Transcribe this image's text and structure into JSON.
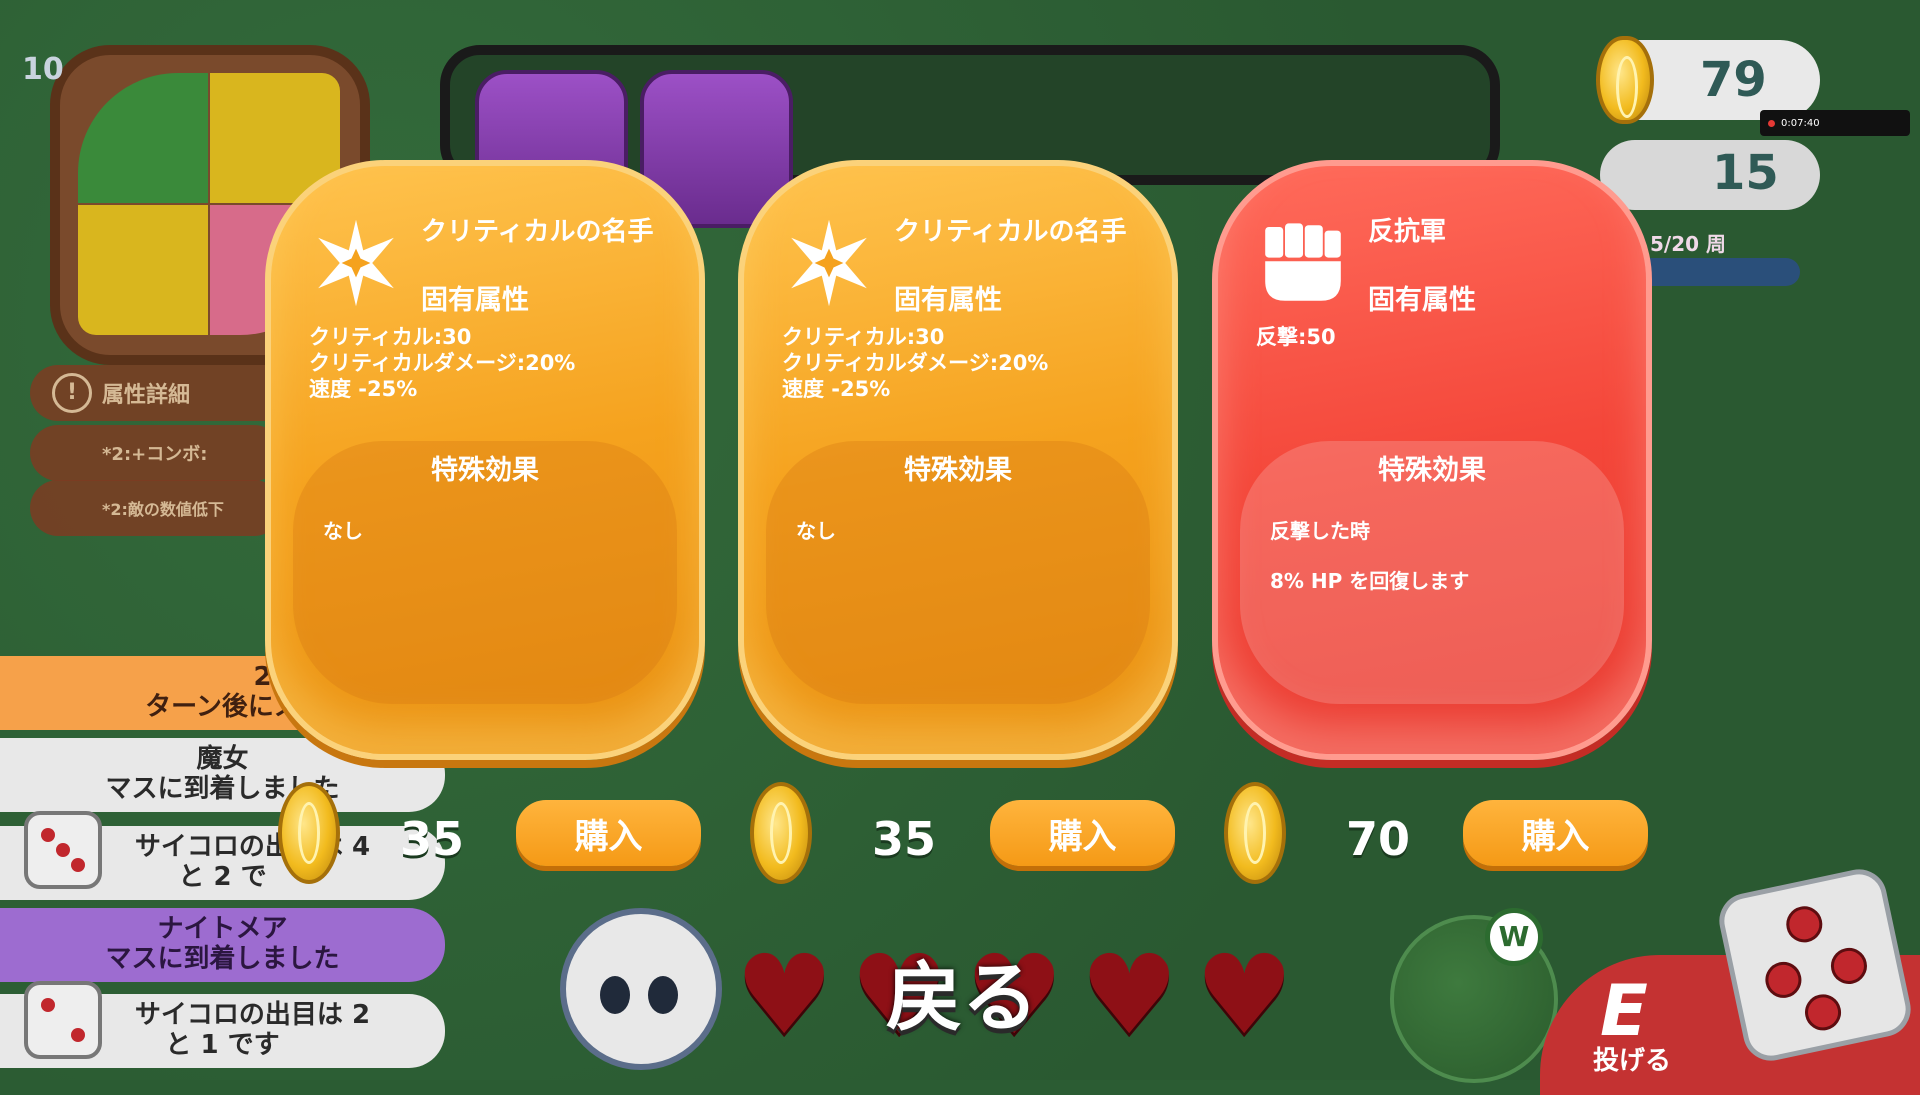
{
  "hud": {
    "level": "10",
    "coins": "79",
    "round": "15",
    "laps": "5/20 周",
    "recording_time": "0:07:40"
  },
  "sidebar": {
    "attribute_detail": "属性詳細",
    "combo_note": "*2:+コンボ:",
    "enemy_note": "*2:敵の数値低下"
  },
  "event_log": [
    {
      "line1": "2",
      "line2": "ターン後にス"
    },
    {
      "line1": "魔女",
      "line2": "マスに到着しました"
    },
    {
      "line1": "サイコロの出目は 4",
      "line2": "と 2 で"
    },
    {
      "line1": "ナイトメア",
      "line2": "マスに到着しました"
    },
    {
      "line1": "サイコロの出目は 2",
      "line2": "と 1 です"
    }
  ],
  "shop": {
    "cards": [
      {
        "icon": "star-burst-icon",
        "title": "クリティカルの名手",
        "subtitle": "固有属性",
        "stats": [
          "クリティカル:30",
          "クリティカルダメージ:20%",
          "速度 -25%"
        ],
        "effect_title": "特殊効果",
        "effect_lines": [
          "なし"
        ],
        "price": "35",
        "buy_label": "購入",
        "color": "#f5a21e"
      },
      {
        "icon": "star-burst-icon",
        "title": "クリティカルの名手",
        "subtitle": "固有属性",
        "stats": [
          "クリティカル:30",
          "クリティカルダメージ:20%",
          "速度 -25%"
        ],
        "effect_title": "特殊効果",
        "effect_lines": [
          "なし"
        ],
        "price": "35",
        "buy_label": "購入",
        "color": "#f5a21e"
      },
      {
        "icon": "fist-icon",
        "title": "反抗軍",
        "subtitle": "固有属性",
        "stats": [
          "反撃:50"
        ],
        "effect_title": "特殊効果",
        "effect_lines": [
          "反撃した時",
          "8% HP を回復します"
        ],
        "price": "70",
        "buy_label": "購入",
        "color": "#f4473a"
      }
    ],
    "back_label": "戻る"
  },
  "bottom": {
    "hearts": 5,
    "power_badge": "W",
    "throw_key": "E",
    "throw_label": "投げる"
  }
}
